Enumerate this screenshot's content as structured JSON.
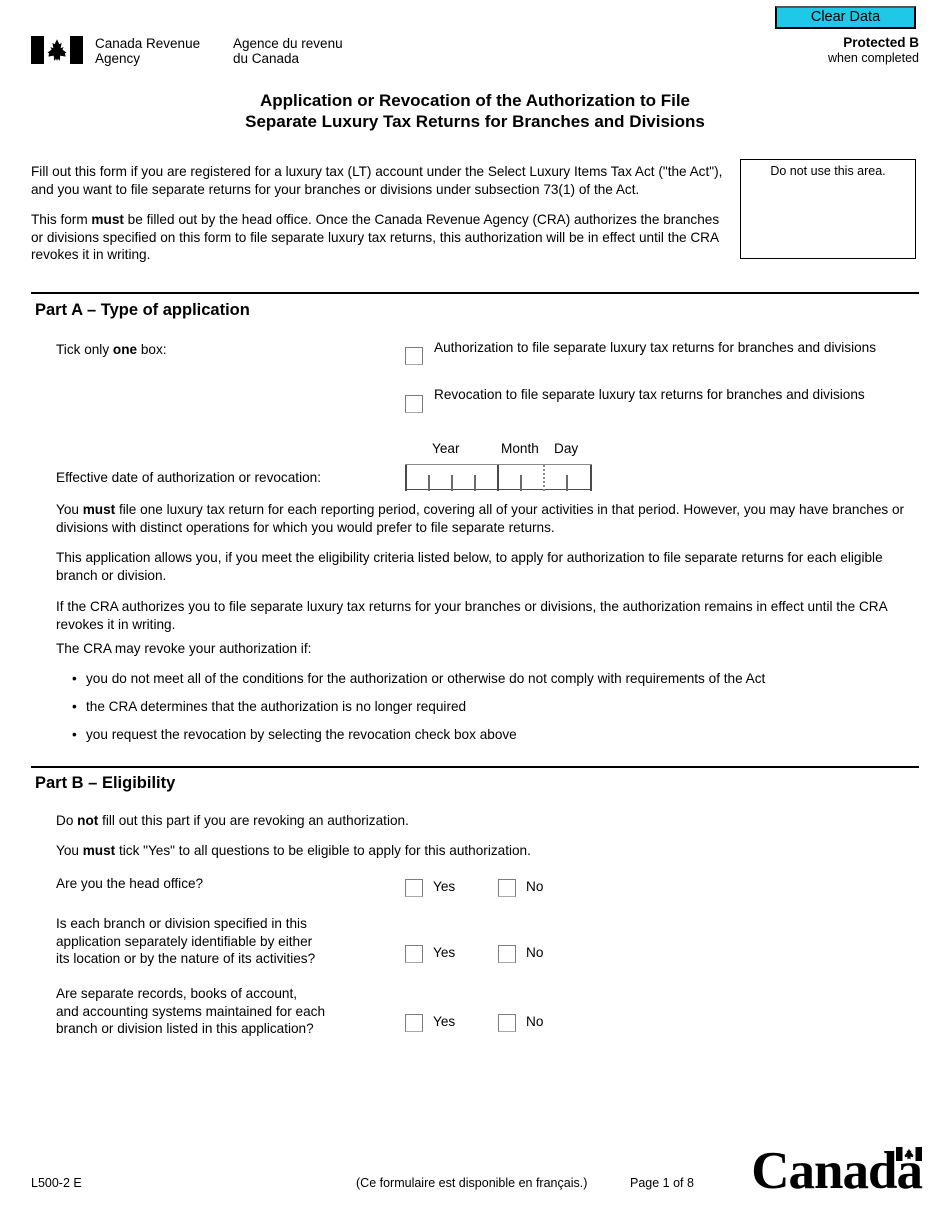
{
  "header": {
    "clear_data_label": "Clear Data",
    "agency_en": "Canada Revenue\nAgency",
    "agency_fr": "Agence du revenu\ndu Canada",
    "protected_label": "Protected B",
    "protected_sub": "when completed"
  },
  "title": "Application or Revocation of the Authorization to File\nSeparate Luxury Tax Returns for Branches and Divisions",
  "intro": {
    "p1": "Fill out this form if you are registered for a luxury tax (LT) account under the Select Luxury Items Tax Act (\"the Act\"), and you want to file separate returns for your branches or divisions under subsection 73(1) of the Act.",
    "p2_before": "This form ",
    "p2_bold": "must",
    "p2_after": " be filled out by the head office. Once the Canada Revenue Agency (CRA) authorizes the branches or divisions specified on this form to file separate luxury tax returns, this authorization will be in effect until the CRA revokes it in writing.",
    "do_not_use": "Do not use this area."
  },
  "part_a": {
    "heading": "Part A – Type of application",
    "tick_before": "Tick only ",
    "tick_bold": "one",
    "tick_after": " box:",
    "option_authorization": "Authorization to file separate luxury tax returns for branches and divisions",
    "option_revocation": "Revocation to file separate luxury tax returns for branches and divisions",
    "date_label": "Effective date of authorization or revocation:",
    "date_header_year": "Year",
    "date_header_month": "Month",
    "date_header_day": "Day",
    "date_value": "",
    "p1_before": "You ",
    "p1_bold": "must",
    "p1_after": " file one luxury tax return for each reporting period, covering all of your activities in that period. However, you may have branches or divisions with distinct operations for which you would prefer to file separate returns.",
    "p2": "This application allows you, if you meet the eligibility criteria listed below, to apply for authorization to file separate returns for each eligible branch or division.",
    "p3": "If the CRA authorizes you to file separate luxury tax returns for your branches or divisions, the authorization remains in effect until the CRA revokes it in writing.",
    "revoke_intro": "The CRA may revoke your authorization if:",
    "revoke_bullets": [
      "you do not meet all of the conditions for the authorization or otherwise do not comply with requirements of the Act",
      "the CRA determines that the authorization is no longer required",
      "you request the revocation by selecting the revocation check box above"
    ]
  },
  "part_b": {
    "heading": "Part B – Eligibility",
    "note1_before": "Do ",
    "note1_bold": "not",
    "note1_after": " fill out this part if you are revoking an authorization.",
    "note2_before": "You ",
    "note2_bold": "must",
    "note2_after": " tick \"Yes\" to all questions to be eligible to apply for this authorization.",
    "yes_label": "Yes",
    "no_label": "No",
    "questions": [
      {
        "text": "Are you the head office?"
      },
      {
        "text": "Is each branch or division specified in this\napplication separately identifiable by either\nits location or by the nature of its activities?"
      },
      {
        "text": "Are separate records, books of account,\nand accounting systems maintained for each\nbranch or division listed in this application?"
      }
    ]
  },
  "footer": {
    "form_code": "L500-2 E",
    "french_note": "(Ce formulaire est disponible en français.)",
    "page_number": "Page 1 of 8",
    "wordmark": "Canada"
  },
  "colors": {
    "clear_data_bg": "#1ec8e6",
    "text": "#000000",
    "checkbox_border": "#7c7c7c"
  }
}
